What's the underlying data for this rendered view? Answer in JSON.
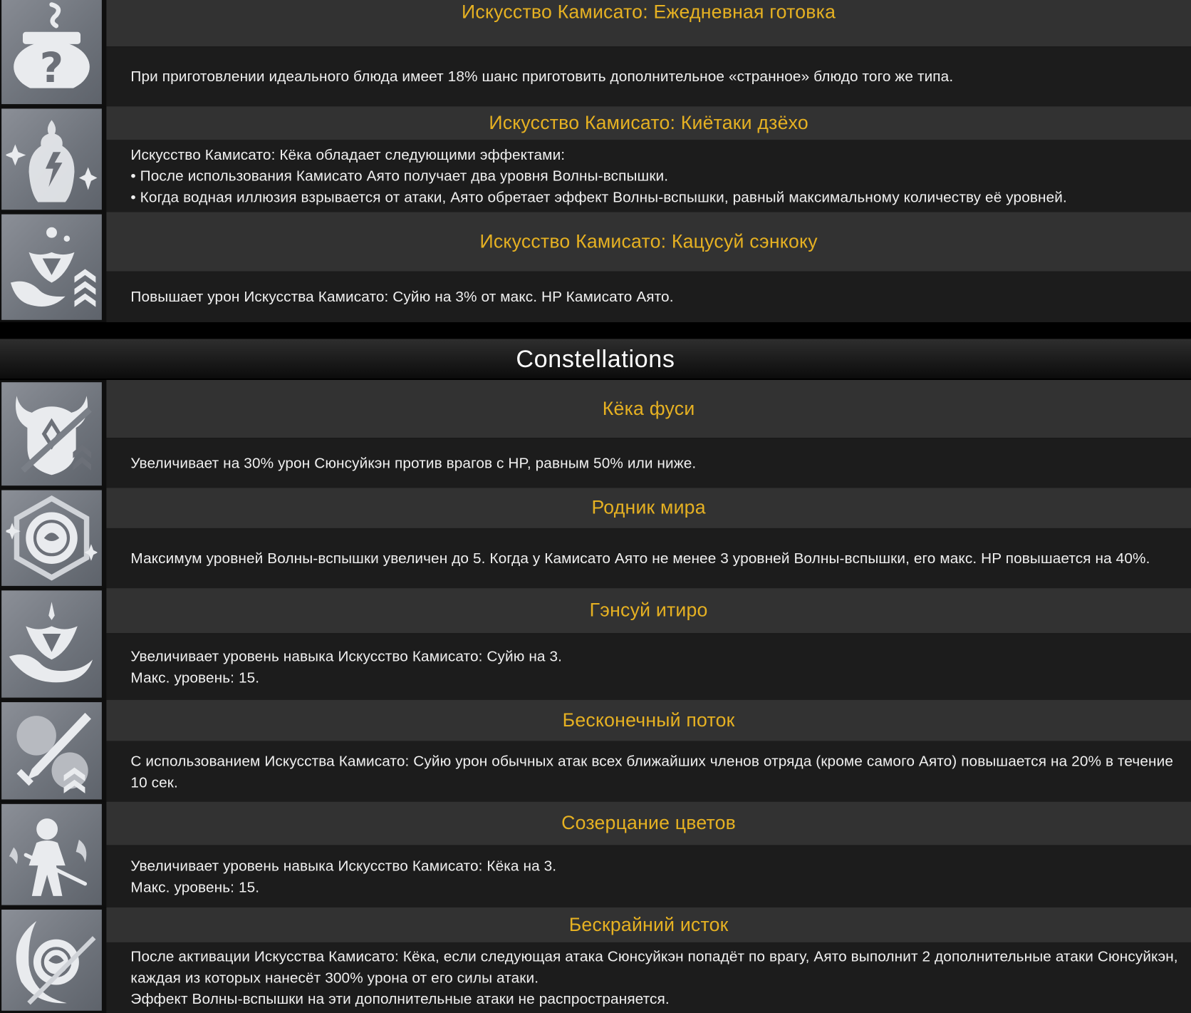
{
  "passives": [
    {
      "icon": "pot-question-icon",
      "title": "Искусство Камисато: Ежедневная готовка",
      "lines": [
        "При приготовлении идеального блюда имеет 18% шанс приготовить дополнительное «странное» блюдо того же типа."
      ]
    },
    {
      "icon": "lightning-figure-icon",
      "title": "Искусство Камисато: Киётаки дзёхо",
      "lines": [
        "Искусство Камисато: Кёка обладает следующими эффектами:",
        "• После использования Камисато Аято получает два уровня Волны-вспышки.",
        "• Когда водная иллюзия взрывается от атаки, Аято обретает эффект Волны-вспышки, равный максимальному количеству её уровней."
      ]
    },
    {
      "icon": "flower-wave-chevron-icon",
      "title": "Искусство Камисато: Кацусуй сэнкоку",
      "lines": [
        "Повышает урон Искусства Камисато: Суйю на 3% от макс. HP Камисато Аято."
      ]
    }
  ],
  "section_title": "Constellations",
  "constellations": [
    {
      "icon": "horned-helmet-icon",
      "title": "Кёка фуси",
      "lines": [
        "Увеличивает на 30% урон Сюнсуйкэн против врагов с HP, равным 50% или ниже."
      ]
    },
    {
      "icon": "hexagon-flower-icon",
      "title": "Родник мира",
      "lines": [
        "Максимум уровней Волны-вспышки увеличен до 5. Когда у Камисато Аято не менее 3 уровней Волны-вспышки, его макс. HP повышается на 40%."
      ]
    },
    {
      "icon": "flower-wave-icon",
      "title": "Гэнсуй итиро",
      "lines": [
        "Увеличивает уровень навыка Искусство Камисато: Суйю на 3.",
        "Макс. уровень: 15."
      ]
    },
    {
      "icon": "sword-flower-icon",
      "title": "Бесконечный поток",
      "lines": [
        "С использованием Искусства Камисато: Суйю урон обычных атак всех ближайших членов отряда (кроме самого Аято) повышается на 20% в течение 10 сек."
      ]
    },
    {
      "icon": "swordsman-icon",
      "title": "Созерцание цветов",
      "lines": [
        "Увеличивает уровень навыка Искусство Камисато: Кёка на 3.",
        "Макс. уровень: 15."
      ]
    },
    {
      "icon": "crescent-flower-icon",
      "title": "Бескрайний исток",
      "lines": [
        "После активации Искусства Камисато: Кёка, если следующая атака Сюнсуйкэн попадёт по врагу, Аято выполнит 2 дополнительные атаки Сюнсуйкэн, каждая из которых нанесёт 300% урона от его силы атаки.",
        "Эффект Волны-вспышки на эти дополнительные атаки не распространяется."
      ]
    }
  ]
}
